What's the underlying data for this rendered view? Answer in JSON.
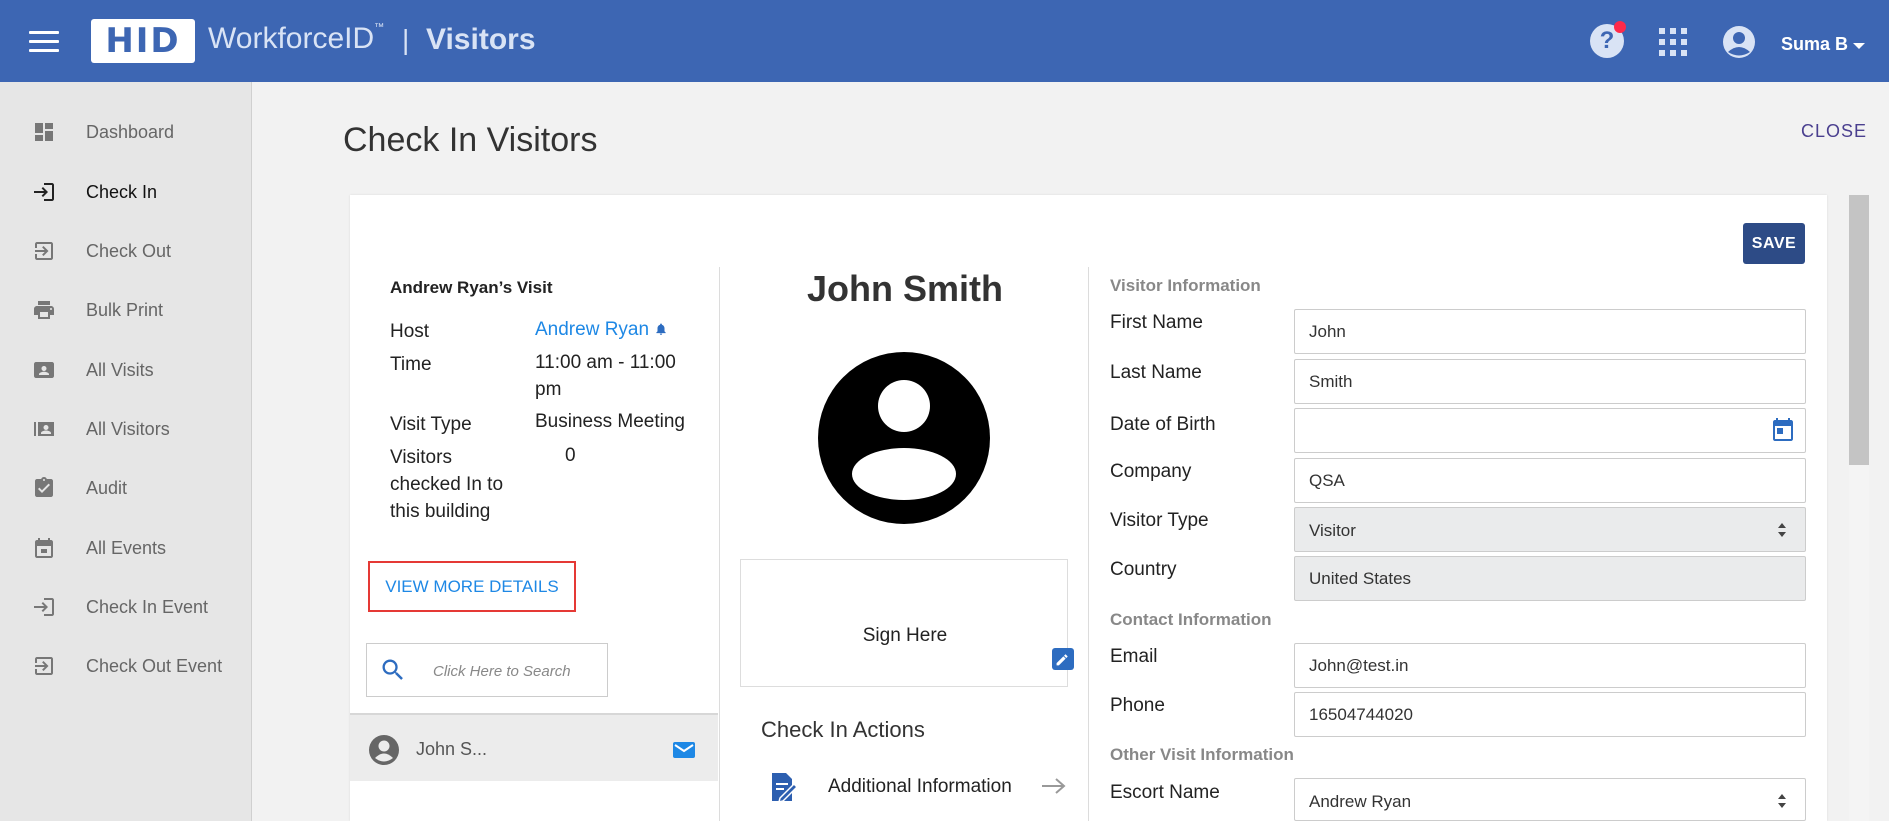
{
  "header": {
    "logo_text": "HID",
    "brand": "WorkforceID",
    "brand_tm": "™",
    "separator": "|",
    "app_name": "Visitors",
    "help_symbol": "?",
    "user_name": "Suma B",
    "colors": {
      "bar": "#3d66b3",
      "notification_dot": "#ff2a4a"
    }
  },
  "sidebar": {
    "items": [
      {
        "label": "Dashboard",
        "icon": "dashboard-icon",
        "active": false
      },
      {
        "label": "Check In",
        "icon": "check-in-icon",
        "active": true
      },
      {
        "label": "Check Out",
        "icon": "check-out-icon",
        "active": false
      },
      {
        "label": "Bulk Print",
        "icon": "print-icon",
        "active": false
      },
      {
        "label": "All Visits",
        "icon": "visits-icon",
        "active": false
      },
      {
        "label": "All Visitors",
        "icon": "visitors-icon",
        "active": false
      },
      {
        "label": "Audit",
        "icon": "audit-icon",
        "active": false
      },
      {
        "label": "All Events",
        "icon": "calendar-icon",
        "active": false
      },
      {
        "label": "Check In Event",
        "icon": "check-in-event-icon",
        "active": false
      },
      {
        "label": "Check Out Event",
        "icon": "check-out-event-icon",
        "active": false
      }
    ]
  },
  "page": {
    "title": "Check In Visitors",
    "close_label": "CLOSE",
    "save_label": "SAVE"
  },
  "visit": {
    "title": "Andrew Ryan’s Visit",
    "host_label": "Host",
    "host_value": "Andrew Ryan",
    "time_label": "Time",
    "time_value_line1": "11:00 am - 11:00",
    "time_value_line2": "pm",
    "type_label": "Visit Type",
    "type_value": "Business Meeting",
    "count_label_line1": "Visitors",
    "count_label_line2": "checked In to",
    "count_label_line3": "this building",
    "count_value": "0",
    "more_details_label": "VIEW MORE DETAILS",
    "search_placeholder": "Click Here to Search",
    "visitor_list": [
      {
        "name": "John S..."
      }
    ]
  },
  "visitor": {
    "name": "John Smith",
    "sign_label": "Sign Here",
    "actions_title": "Check In Actions",
    "actions": [
      {
        "label": "Additional Information",
        "icon": "additional-info-icon"
      }
    ]
  },
  "form": {
    "visitor_info_title": "Visitor Information",
    "first_name_label": "First Name",
    "first_name_value": "John",
    "last_name_label": "Last Name",
    "last_name_value": "Smith",
    "dob_label": "Date of Birth",
    "dob_value": "",
    "company_label": "Company",
    "company_value": "QSA",
    "visitor_type_label": "Visitor Type",
    "visitor_type_value": "Visitor",
    "country_label": "Country",
    "country_value": "United States",
    "contact_info_title": "Contact Information",
    "email_label": "Email",
    "email_value": "John@test.in",
    "phone_label": "Phone",
    "phone_value": "16504744020",
    "other_info_title": "Other Visit Information",
    "escort_label": "Escort Name",
    "escort_value": "Andrew Ryan"
  }
}
